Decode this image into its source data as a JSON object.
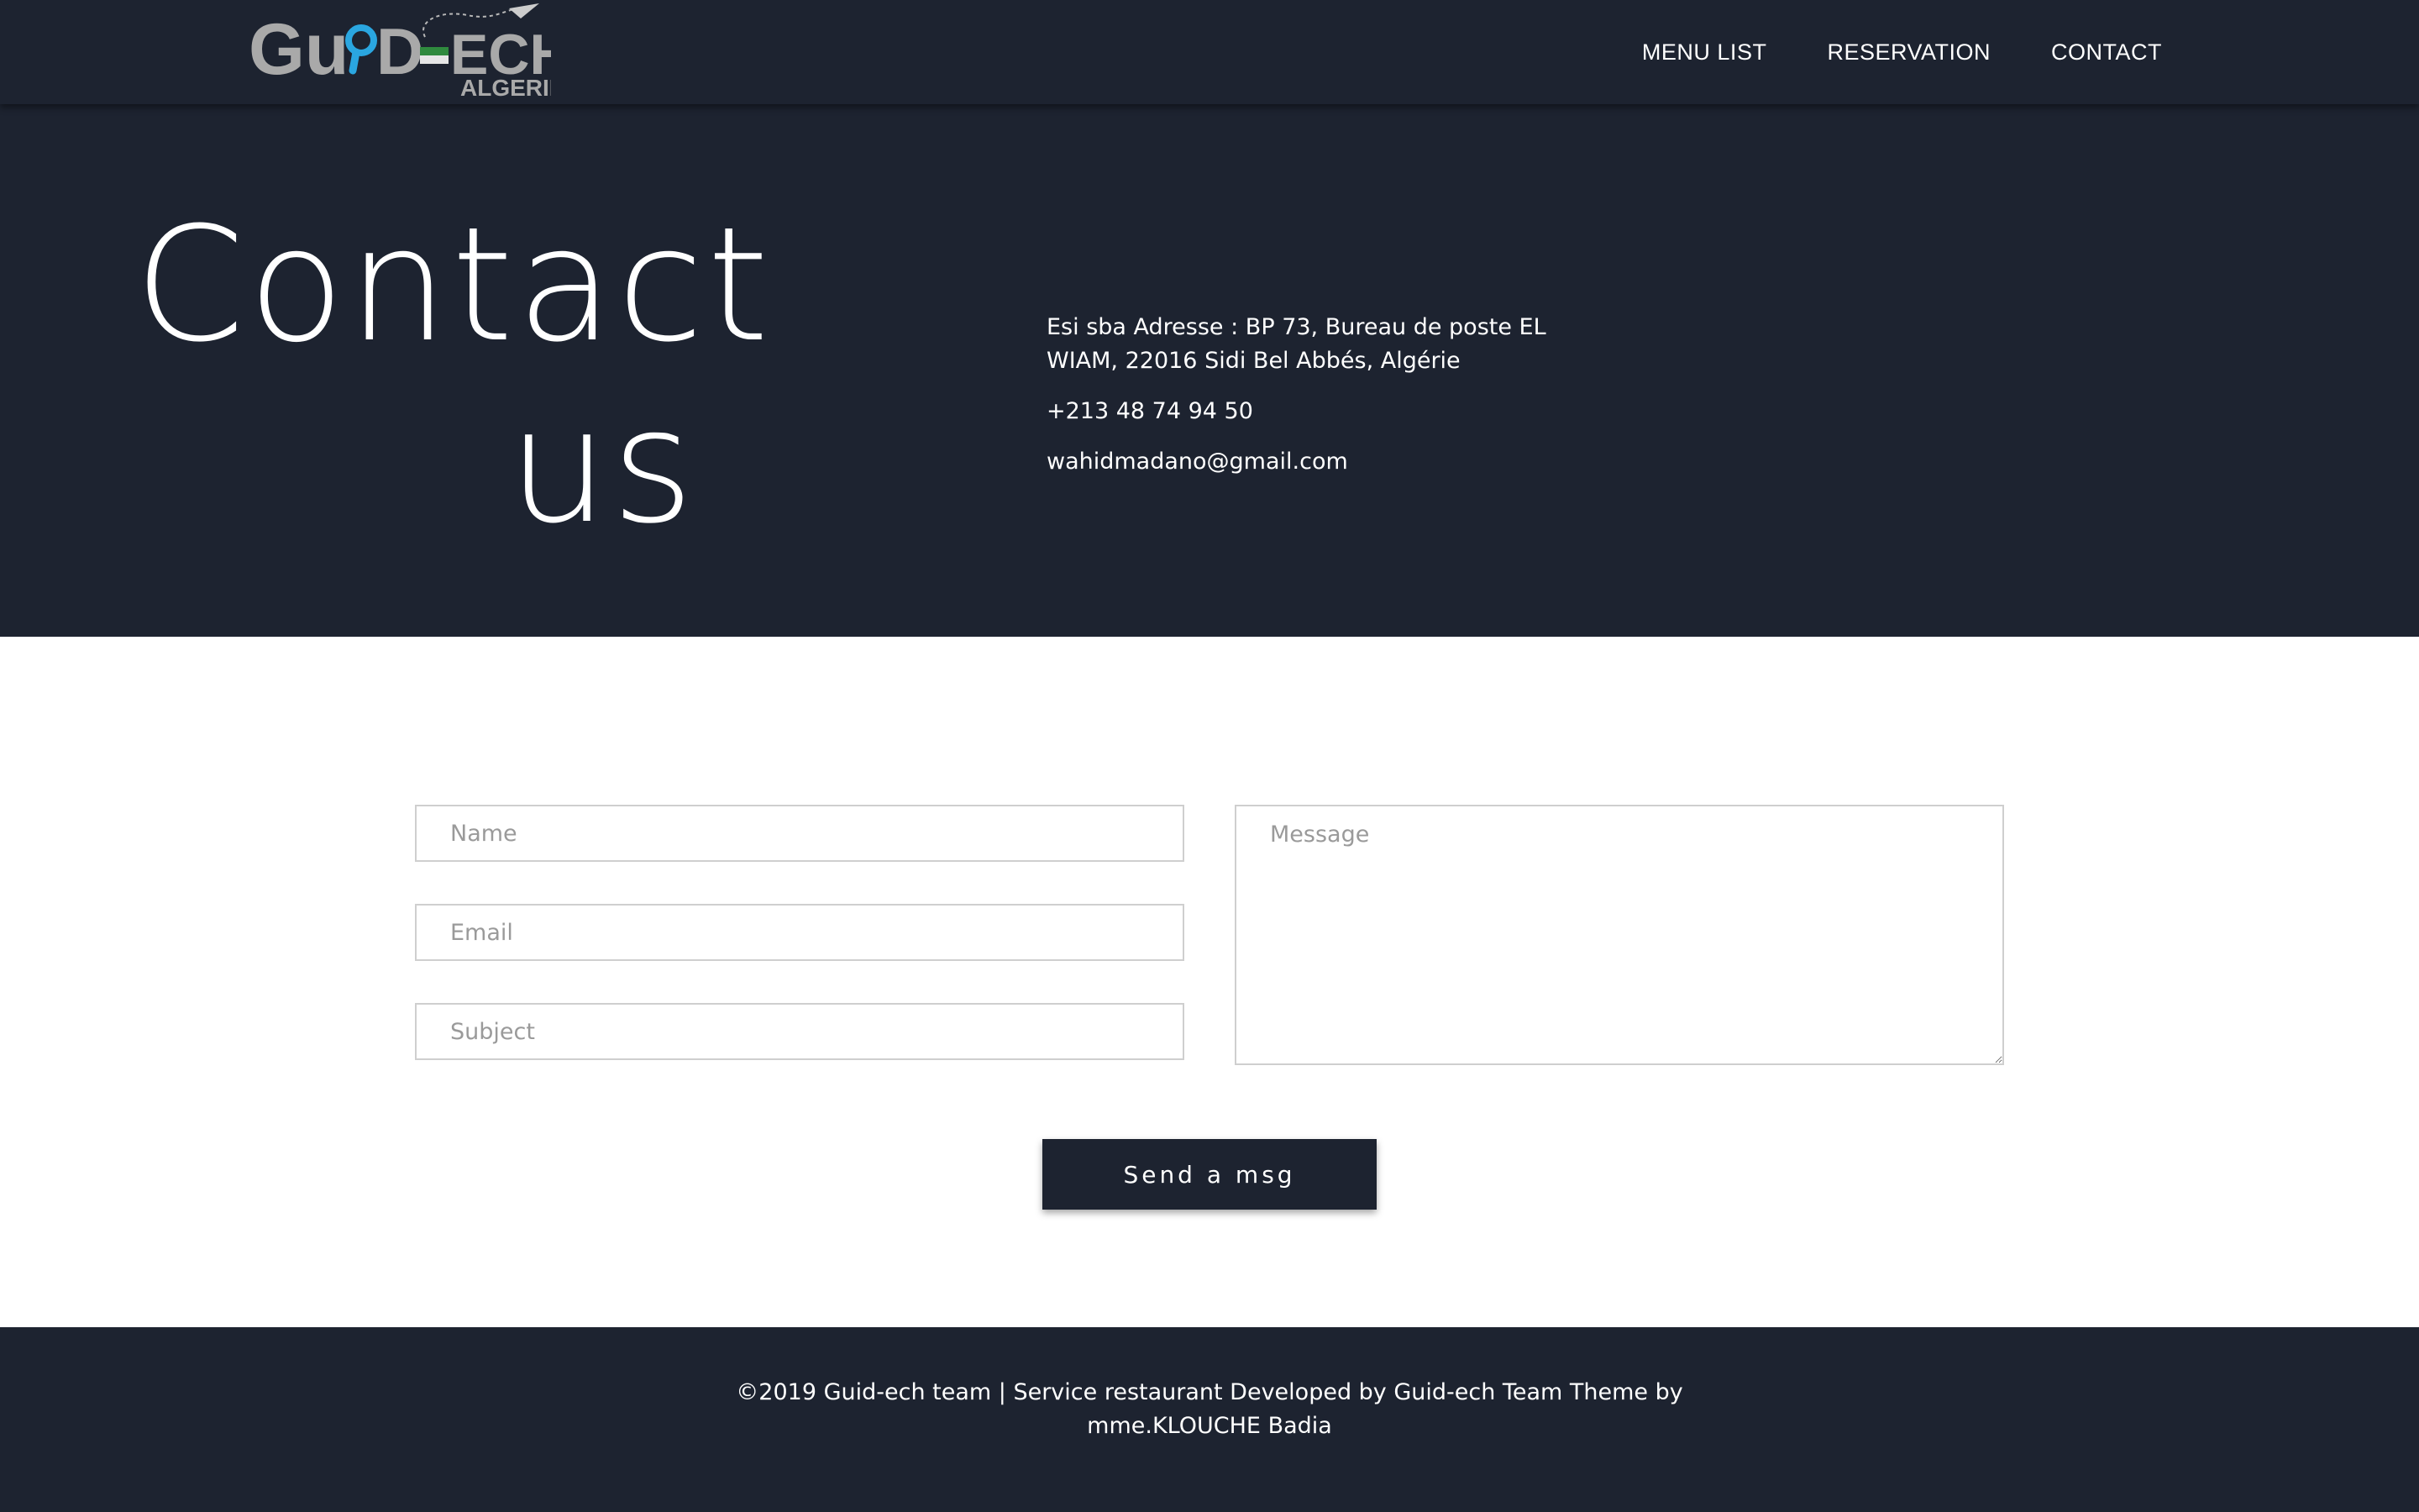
{
  "brand": {
    "logo_main": "GuidTech",
    "logo_sub": "ALGERIE"
  },
  "nav": {
    "items": [
      {
        "label": "MENU LIST"
      },
      {
        "label": "RESERVATION"
      },
      {
        "label": "CONTACT"
      }
    ]
  },
  "hero": {
    "title_line1": "Contact",
    "title_line2": "us"
  },
  "contact_info": {
    "address": "Esi sba Adresse : BP 73, Bureau de poste EL WIAM, 22016 Sidi Bel Abbés, Algérie",
    "phone": "+213 48 74 94 50",
    "email": "wahidmadano@gmail.com"
  },
  "form": {
    "name_placeholder": "Name",
    "email_placeholder": "Email",
    "subject_placeholder": "Subject",
    "message_placeholder": "Message",
    "submit_label": "Send a msg"
  },
  "footer": {
    "text": "©2019 Guid-ech team | Service restaurant Developed by Guid-ech Team Theme by mme.KLOUCHE Badia"
  },
  "colors": {
    "dark_bg": "#1d2330",
    "logo_gray": "#a9a9a9",
    "logo_blue": "#2aa6e0"
  }
}
